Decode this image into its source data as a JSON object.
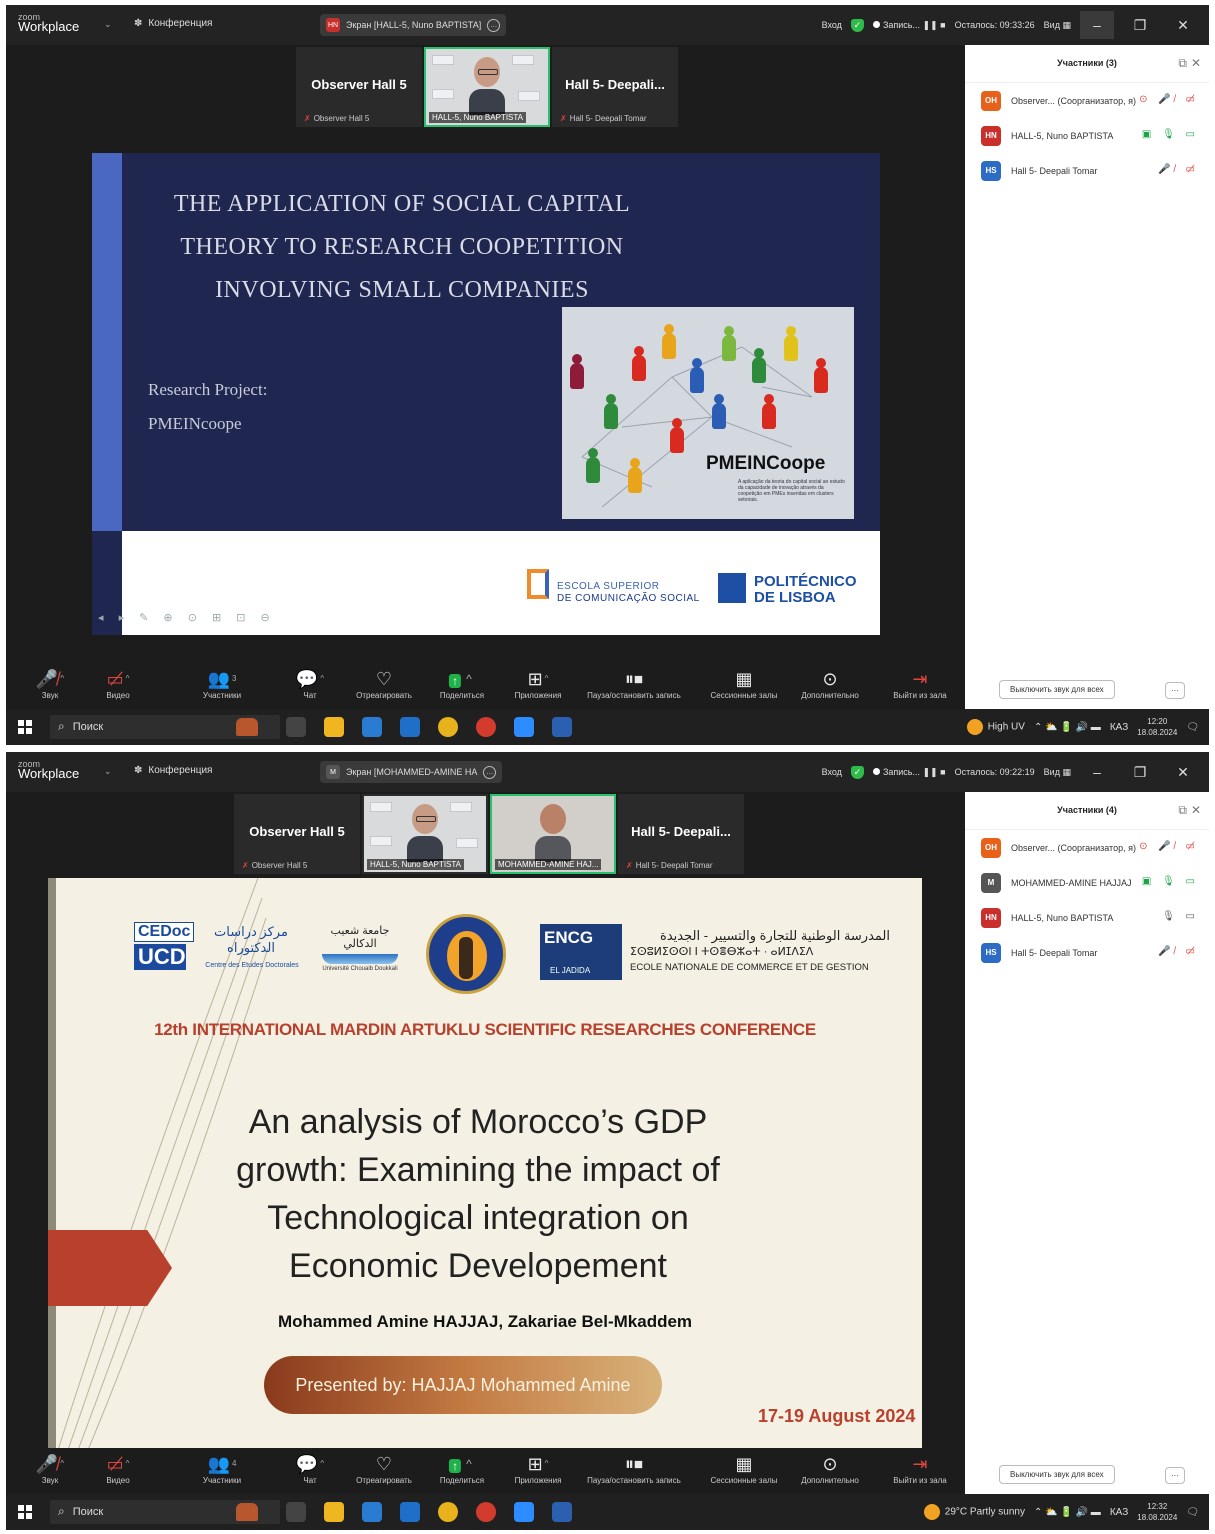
{
  "colors": {
    "accent_green": "#25c16f",
    "rec_red": "#e0463d",
    "slide1_bg": "#1f2750",
    "slide2_accent": "#b8402c"
  },
  "frames": [
    {
      "titlebar": {
        "logo_small": "zoom",
        "logo_large": "Workplace",
        "menu_arrow": "⌄",
        "conference": "Конференция",
        "share_initials": "HN",
        "share_label": "Экран [HALL-5, Nuno BAPTISTA]",
        "signin": "Вход",
        "record": "Запись...",
        "remaining": "Осталось: 09:33:26",
        "view": "Вид"
      },
      "thumbs": [
        {
          "name": "Observer Hall 5",
          "label": "Observer Hall 5"
        },
        {
          "label": "HALL-5, Nuno BAPTISTA"
        },
        {
          "name": "Hall 5- Deepali...",
          "label": "Hall 5- Deepali Tomar"
        }
      ],
      "panel": {
        "title": "Участники (3)",
        "participants": [
          {
            "initials": "OH",
            "color": "#e8611a",
            "name": "Observer... (Соорганизатор, я)",
            "icons": "⊙ 🎤̸ ▭̸"
          },
          {
            "initials": "HN",
            "color": "#c9302c",
            "name": "HALL-5, Nuno BAPTISTA",
            "icons": "▣ 🎙 ▭"
          },
          {
            "initials": "HS",
            "color": "#2d6cc4",
            "name": "Hall 5- Deepali Tomar",
            "icons": "🎤̸ ▭̸"
          }
        ],
        "mute_all": "Выключить звук для всех",
        "more": "···"
      },
      "slide": {
        "title_line1": "THE APPLICATION OF SOCIAL CAPITAL",
        "title_line2": "THEORY TO RESEARCH COOPETITION",
        "title_line3": "INVOLVING SMALL COMPANIES",
        "research_project": "Research Project:",
        "project_name": "PMEINcoope",
        "photo_title": "PMEINCoope",
        "photo_sub": "A aplicação da teoria do capital social ao estudo da capacidade de inovação através da coopetição em PMEs inseridas em clusters setoriais.",
        "escola_line1": "ESCOLA SUPERIOR",
        "escola_line2": "DE COMUNICAÇÃO SOCIAL",
        "poli_line1": "POLITÉCNICO",
        "poli_line2": "DE LISBOA",
        "controls": "◂ ▸ ✎ ⊕ ⊙ ⊞ ⊡ ⊖"
      },
      "toolbar": {
        "participants_count": "3",
        "items": [
          "Звук",
          "Видео",
          "Участники",
          "Чат",
          "Отреагировать",
          "Поделиться",
          "Приложения",
          "Пауза/остановить запись",
          "Сессионные залы",
          "Дополнительно",
          "Выйти из зала"
        ]
      },
      "taskbar": {
        "search": "Поиск",
        "weather": "High UV",
        "lang": "КАЗ",
        "time": "12:20",
        "date": "18.08.2024"
      }
    },
    {
      "titlebar": {
        "logo_small": "zoom",
        "logo_large": "Workplace",
        "menu_arrow": "⌄",
        "conference": "Конференция",
        "share_initials": "M",
        "share_label": "Экран [MOHAMMED-AMINE HA",
        "signin": "Вход",
        "record": "Запись...",
        "remaining": "Осталось: 09:22:19",
        "view": "Вид"
      },
      "thumbs": [
        {
          "name": "Observer Hall 5",
          "label": "Observer Hall 5"
        },
        {
          "label": "HALL-5, Nuno BAPTISTA"
        },
        {
          "label": "MOHAMMED-AMINE HAJ..."
        },
        {
          "name": "Hall 5- Deepali...",
          "label": "Hall 5- Deepali Tomar"
        }
      ],
      "panel": {
        "title": "Участники (4)",
        "participants": [
          {
            "initials": "OH",
            "color": "#e8611a",
            "name": "Observer... (Соорганизатор, я)",
            "icons": "⊙ 🎤̸ ▭̸"
          },
          {
            "initials": "M",
            "color": "#555555",
            "name": "MOHAMMED-AMINE HAJJAJ",
            "icons": "▣ 🎙 ▭"
          },
          {
            "initials": "HN",
            "color": "#c9302c",
            "name": "HALL-5, Nuno BAPTISTA",
            "icons": "🎙 ▭"
          },
          {
            "initials": "HS",
            "color": "#2d6cc4",
            "name": "Hall 5- Deepali Tomar",
            "icons": "🎤̸ ▭̸"
          }
        ],
        "mute_all": "Выключить звук для всех",
        "more": "···"
      },
      "slide": {
        "cedoc_top": "CEDoc",
        "cedoc_bottom": "UCD",
        "cedoc_ar": "مركز دراسات الدكتوراه",
        "cedoc_fr": "Centre des Etudes Doctorales",
        "uni_ar": "جامعة شعيب الدكالي",
        "uni_en": "Université Chouaib Doukkali",
        "encg_top": "ENCG",
        "encg_bottom": "EL JADIDA",
        "encg_ar": "المدرسة الوطنية للتجارة والتسيير - الجديدة",
        "encg_tf": "ⵉⵙⵓⵍⵉⵙⵙⵏ ⵏ ⵜⵙⴻⴱⵣⴰⵜ · ⴰⵍⵊⴷⵉⴷ",
        "encg_fr": "ECOLE NATIONALE DE COMMERCE ET DE GESTION",
        "conference": "12th INTERNATIONAL MARDIN ARTUKLU SCIENTIFIC RESEARCHES CONFERENCE",
        "title_line1": "An analysis of Morocco’s GDP",
        "title_line2": "growth: Examining the impact of",
        "title_line3": "Technological integration on",
        "title_line4": "Economic Developement",
        "authors": "Mohammed Amine HAJJAJ, Zakariae Bel-Mkaddem",
        "presented": "Presented by: HAJJAJ Mohammed Amine",
        "date": "17-19 August 2024"
      },
      "toolbar": {
        "participants_count": "4",
        "items": [
          "Звук",
          "Видео",
          "Участники",
          "Чат",
          "Отреагировать",
          "Поделиться",
          "Приложения",
          "Пауза/остановить запись",
          "Сессионные залы",
          "Дополнительно",
          "Выйти из зала"
        ]
      },
      "taskbar": {
        "search": "Поиск",
        "weather": "29°C Partly sunny",
        "lang": "КАЗ",
        "time": "12:32",
        "date": "18.08.2024"
      }
    }
  ]
}
